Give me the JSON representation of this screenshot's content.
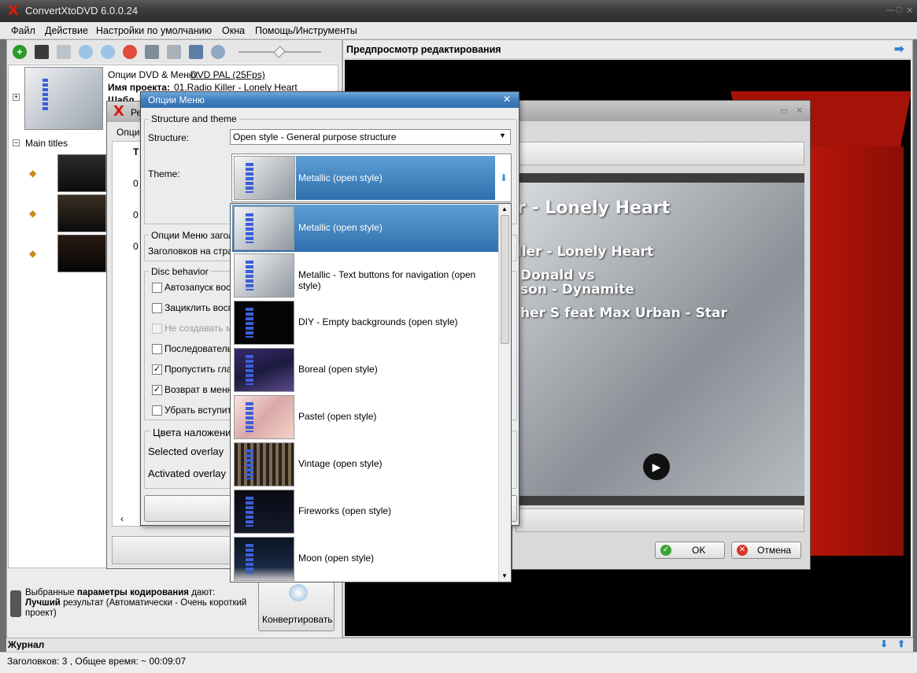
{
  "app": {
    "title": "ConvertXtoDVD 6.0.0.24"
  },
  "menu": [
    "Файл",
    "Действие",
    "Настройки по умолчанию",
    "Окна",
    "Помощь/Инструменты"
  ],
  "project": {
    "options_label": "Опции DVD & Меню:",
    "options_value": "DVD PAL (25Fps)",
    "name_label": "Имя проекта:",
    "name_value": "01.Radio Killer - Lonely Heart",
    "template_label": "Шабл",
    "main_titles": "Main titles"
  },
  "encoding": {
    "line1_a": "Выбранные",
    "line1_b": "параметры кодирования",
    "line1_c": "дают:",
    "line2_a": "Лучший",
    "line2_b": "результат (Автоматически - Очень короткий",
    "line3": "проект)",
    "convert": "Конвертировать"
  },
  "preview": {
    "title": "Предпросмотр редактирования",
    "lines": [
      "r - Lonely Heart",
      "ller - Lonely Heart",
      "Donald vs",
      "son - Dynamite",
      "her S feat  Max Urban - Star"
    ]
  },
  "journal": "Журнал",
  "status": "Заголовков: 3 , Общее время: ~ 00:09:07",
  "dlg_back": {
    "title_frag": "Ре",
    "opt_frag": "Опци",
    "t_label": "Т",
    "zero": "0"
  },
  "dlg_right": {
    "ok": "OK",
    "cancel": "Отмена"
  },
  "menu_options": {
    "title": "Опции Меню",
    "group_structure": "Structure and theme",
    "structure_label": "Structure:",
    "structure_value": "Open style - General purpose structure",
    "theme_label": "Theme:",
    "theme_value": "Metallic (open style)",
    "group_menu_titles": "Опции Меню заголо",
    "titles_on_page": "Заголовков на стран",
    "group_disc": "Disc behavior",
    "disc": [
      {
        "label": "Автозапуск восп",
        "checked": false,
        "disabled": false
      },
      {
        "label": "Зациклить воспр",
        "checked": false,
        "disabled": false
      },
      {
        "label": "Не создавать ме",
        "checked": false,
        "disabled": true
      },
      {
        "label": "Последователь",
        "checked": false,
        "disabled": false
      },
      {
        "label": "Пропустить глав",
        "checked": true,
        "disabled": false
      },
      {
        "label": "Возврат в меню",
        "checked": true,
        "disabled": false
      },
      {
        "label": "Убрать вступит",
        "checked": false,
        "disabled": false
      }
    ],
    "group_colors": "Цвета наложени",
    "selected_overlay": "Selected overlay",
    "activated_overlay": "Activated overlay"
  },
  "themes": [
    {
      "label": "Metallic (open style)",
      "selected": true
    },
    {
      "label": "Metallic - Text buttons for navigation (open style)",
      "selected": false
    },
    {
      "label": "DIY - Empty backgrounds (open style)",
      "selected": false
    },
    {
      "label": "Boreal (open style)",
      "selected": false
    },
    {
      "label": "Pastel (open style)",
      "selected": false
    },
    {
      "label": "Vintage (open style)",
      "selected": false
    },
    {
      "label": "Fireworks (open style)",
      "selected": false
    },
    {
      "label": "Moon (open style)",
      "selected": false
    }
  ],
  "colors": {
    "accent": "#3f7fbf",
    "brand_red": "#d81b0b",
    "selection": "#2f6fad"
  }
}
